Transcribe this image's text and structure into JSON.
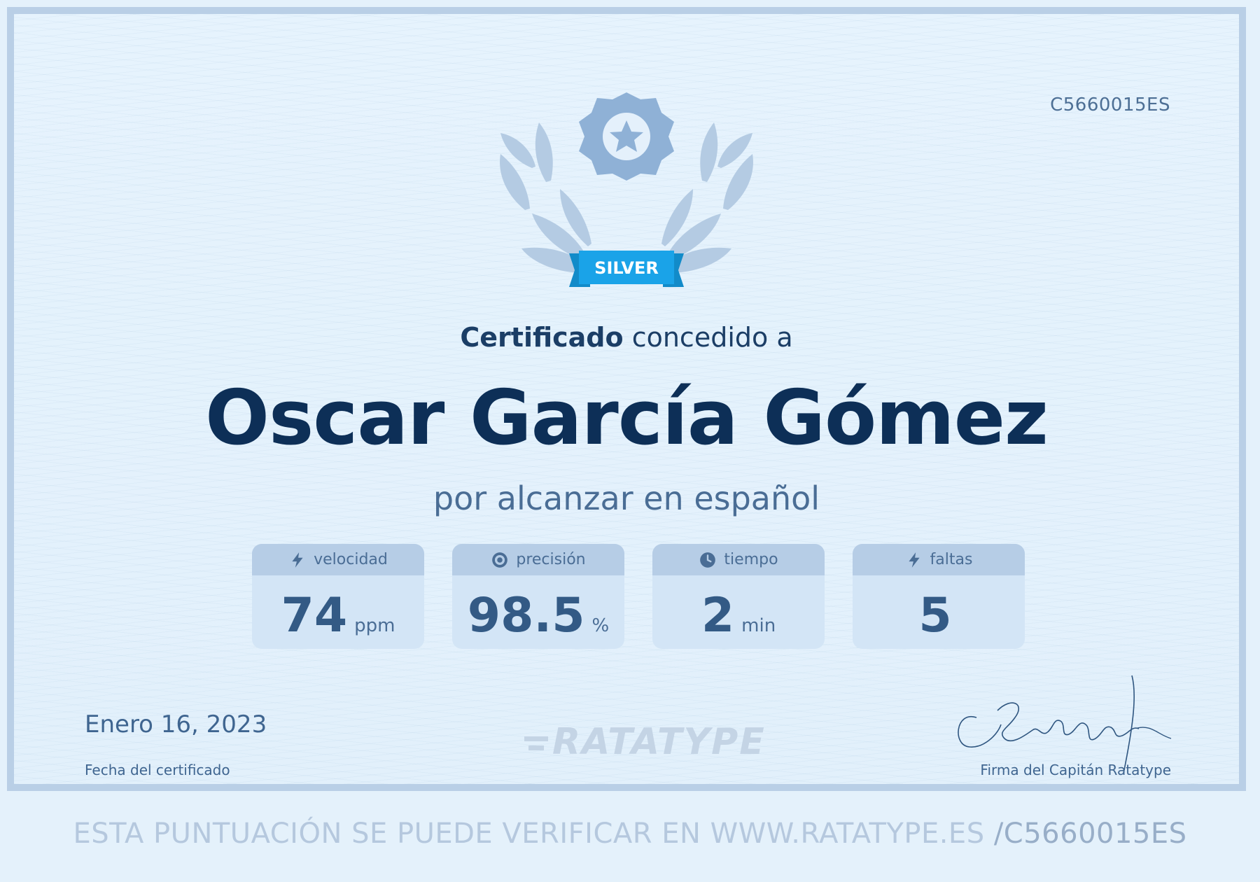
{
  "certificate": {
    "id": "C5660015ES",
    "badge": "SILVER",
    "heading_strong": "Certificado",
    "heading_rest": "concedido a",
    "recipient": "Oscar García Gómez",
    "subtitle": "por alcanzar en español",
    "stats": [
      {
        "label": "velocidad",
        "icon": "bolt-icon",
        "value": "74",
        "unit": "ppm"
      },
      {
        "label": "precisión",
        "icon": "target-icon",
        "value": "98.5",
        "unit": "%"
      },
      {
        "label": "tiempo",
        "icon": "clock-icon",
        "value": "2",
        "unit": "min"
      },
      {
        "label": "faltas",
        "icon": "bolt-icon",
        "value": "5",
        "unit": ""
      }
    ],
    "date": "Enero 16, 2023",
    "date_label": "Fecha del certificado",
    "logo_text": "RATATYPE",
    "signature_label": "Firma del Capitán Ratatype",
    "signature_text": "CRatatype fé",
    "verify_text": "ESTA PUNTUACIÓN SE PUEDE VERIFICAR EN WWW.RATATYPE.ES",
    "verify_id": "/C5660015ES"
  },
  "colors": {
    "border": "#b9cfe6",
    "name": "#0d2f57",
    "ribbon": "#1aa3e8",
    "medal": "#8fb1d6",
    "laurel": "#b4cbe3"
  }
}
